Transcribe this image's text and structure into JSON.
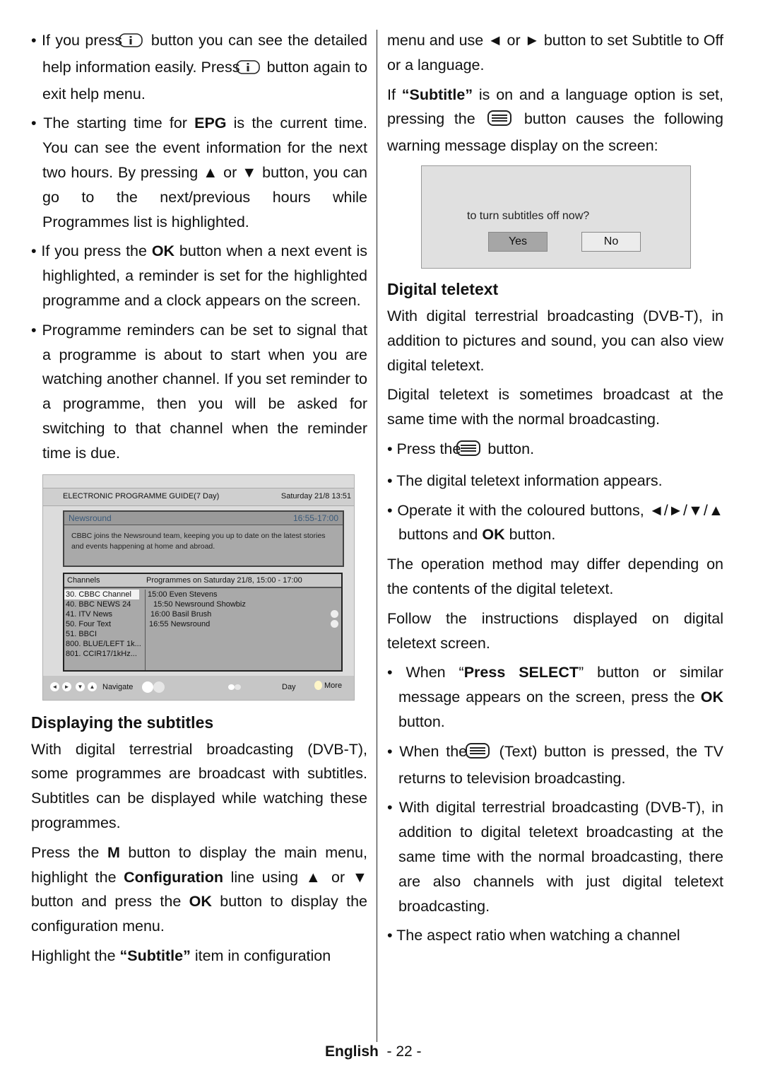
{
  "left": {
    "p1_a": "If you press",
    "p1_b": "button you can see the detailed help information easily. Press",
    "p1_c": "button again to exit help menu.",
    "p2_a": "The starting time for ",
    "p2_b": "EPG",
    "p2_c": " is the current time. You can see the event information for the next two hours. By pressing ▲ or ▼ button, you can go to the next/previous hours while Programmes list is highlighted.",
    "p3_a": "If you press the ",
    "p3_b": "OK",
    "p3_c": " button when a next event is highlighted, a reminder is set for the highlighted programme and a clock appears on the screen.",
    "p4": "Programme reminders can be set to signal that a programme is about to start when you are watching another channel. If you set reminder to a programme, then you will be asked for switching to that channel when the reminder time is due.",
    "h_subtitles": "Displaying the subtitles",
    "p5": "With digital terrestrial broadcasting (DVB-T), some programmes are broadcast with subtitles. Subtitles can be displayed while watching these programmes.",
    "p6_a": "Press the ",
    "p6_b": "M",
    "p6_c": " button to display the main menu, highlight the ",
    "p6_d": "Configuration",
    "p6_e": " line using ▲ or ▼ button and press the ",
    "p6_f": "OK",
    "p6_g": " button to display the configuration menu.",
    "p7_a": "Highlight the ",
    "p7_b": "“Subtitle”",
    "p7_c": " item in configuration"
  },
  "epg": {
    "title": "ELECTRONIC PROGRAMME GUIDE(7 Day)",
    "datetime": "Saturday 21/8 13:51",
    "info_title": "Newsround",
    "info_time": "16:55-17:00",
    "info_desc": "CBBC joins the Newsround team, keeping you up to date on the latest stories and events happening at home and abroad.",
    "col_channels": "Channels",
    "col_programmes": "Programmes on  Saturday 21/8,  15:00 - 17:00",
    "channels": [
      "30. CBBC Channel",
      "40. BBC NEWS 24",
      "41. ITV News",
      "50. Four Text",
      "51. BBCI",
      "800. BLUE/LEFT 1k...",
      "801. CCIR17/1kHz..."
    ],
    "programmes": [
      "15:00 Even Stevens",
      "15:50 Newsround Showbiz",
      "16:00 Basil Brush",
      "16:55 Newsround"
    ],
    "foot_navigate": "Navigate",
    "foot_day": "Day",
    "foot_more": "More"
  },
  "right": {
    "r1": "menu and use ◄ or ► button to set Subtitle to Off or a language.",
    "r2_a": "If ",
    "r2_b": "“Subtitle”",
    "r2_c": " is on and a language option is set, pressing the",
    "r2_d": "button causes the following warning message display on the screen:",
    "dialog_msg": "to turn subtitles off now?",
    "dialog_yes": "Yes",
    "dialog_no": "No",
    "h_teletext": "Digital  teletext",
    "t1": "With digital terrestrial broadcasting (DVB-T), in addition to pictures and sound, you can also view digital teletext.",
    "t2": "Digital teletext is sometimes broadcast at the same time with the normal broadcasting.",
    "b1_a": "Press the",
    "b1_b": "button.",
    "b2": "The digital teletext information appears.",
    "b3_a": "Operate it with the coloured buttons, ◄/►/▼/▲ buttons and ",
    "b3_b": "OK",
    "b3_c": " button.",
    "t3": "The operation method may differ depending on the contents of the digital teletext.",
    "t4": "Follow the instructions displayed on digital teletext screen.",
    "b4_a": "When “",
    "b4_b": "Press SELECT",
    "b4_c": "” button or similar message appears on the screen, press the ",
    "b4_d": "OK",
    "b4_e": " button.",
    "b5_a": "When the",
    "b5_b": "(Text) button is pressed, the TV returns to television broadcasting.",
    "b6": "With digital terrestrial broadcasting (DVB-T), in addition to digital teletext broadcasting at the same time with the normal broadcasting, there are also channels with just digital teletext broadcasting.",
    "b7": "The aspect ratio when watching a channel"
  },
  "footer": {
    "language": "English",
    "page": "- 22 -"
  }
}
